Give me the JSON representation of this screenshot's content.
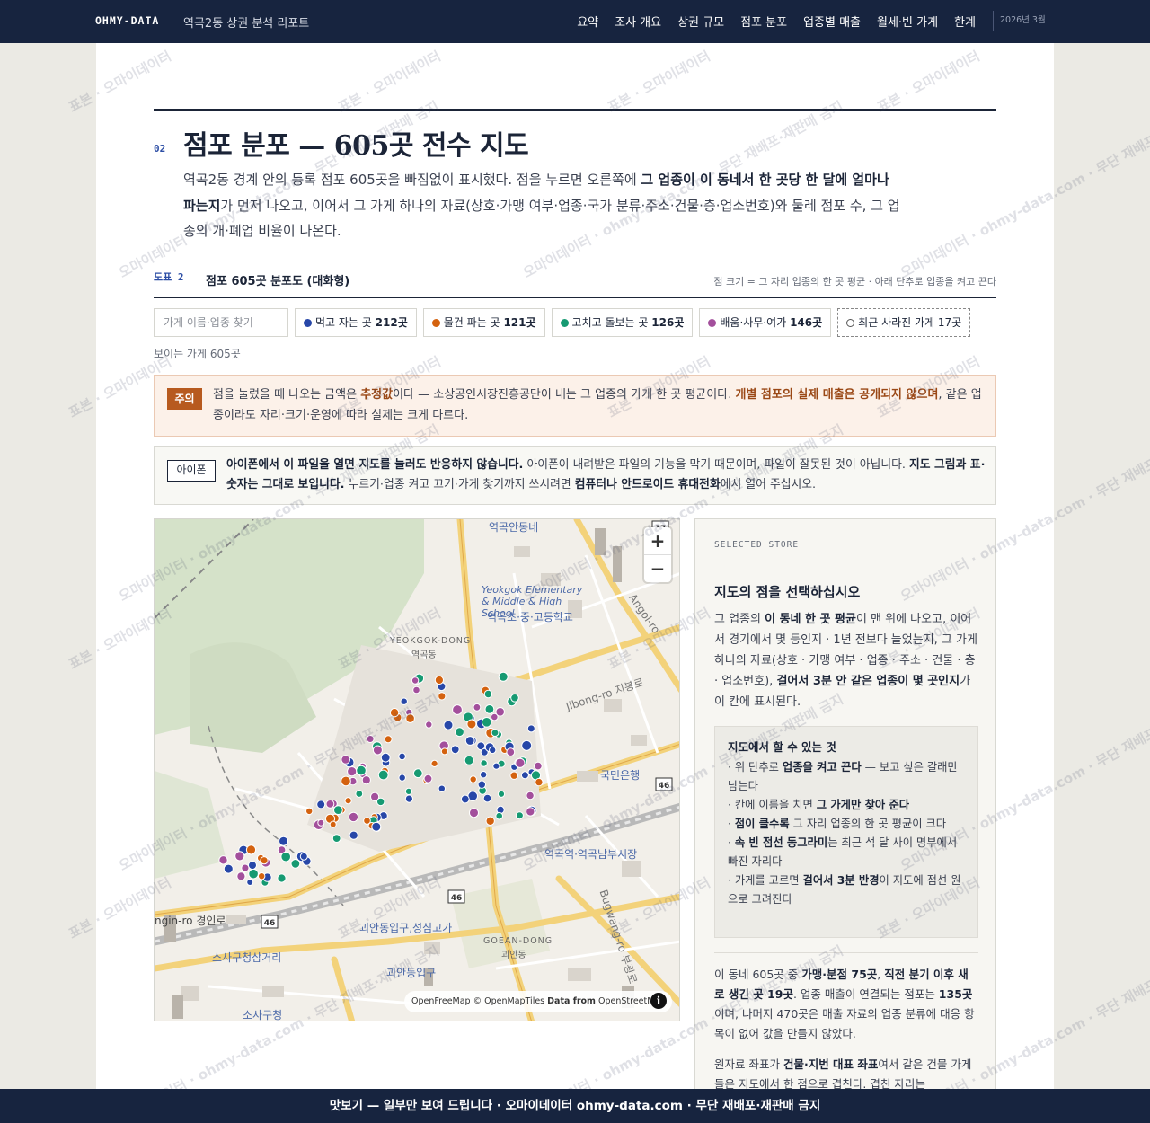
{
  "nav": {
    "brand": "OHMY-DATA",
    "report_title": "역곡2동 상권 분석 리포트",
    "links": [
      "요약",
      "조사 개요",
      "상권 규모",
      "점포 분포",
      "업종별 매출",
      "월세·빈 가게",
      "한계"
    ],
    "date": "2026년 3월"
  },
  "section": {
    "number": "02",
    "title": "점포 분포 — 605곳 전수 지도",
    "intro_1": "역곡2동 경계 안의 등록 점포 605곳을 빠짐없이 표시했다. 점을 누르면 오른쪽에 ",
    "intro_bold": "그 업종이 이 동네서 한 곳당 한 달에 얼마나 파는지",
    "intro_2": "가 먼저 나오고, 이어서 그 가게 하나의 자료(상호·가맹 여부·업종·국가 분류·주소·건물·층·업소번호)와 둘레 점포 수, 그 업종의 개·폐업 비율이 나온다."
  },
  "figure": {
    "caption": "도표 2",
    "title": "점포 605곳 분포도 (대화형)",
    "note": "점 크기 = 그 자리 업종의 한 곳 평균 · 아래 단추로 업종을 켜고 끈다"
  },
  "filters": {
    "search_placeholder": "가게 이름·업종 찾기",
    "chips": [
      {
        "label": "먹고 자는 곳",
        "count": "212곳",
        "color": "#2747a8"
      },
      {
        "label": "물건 파는 곳",
        "count": "121곳",
        "color": "#d4620f"
      },
      {
        "label": "고치고 돌보는 곳",
        "count": "126곳",
        "color": "#169a72"
      },
      {
        "label": "배움·사무·여가",
        "count": "146곳",
        "color": "#a34f9c"
      }
    ],
    "closed_label": "최근 사라진 가게 17곳",
    "visible_count": "보이는 가게 605곳"
  },
  "warning": {
    "tag": "주의",
    "text_1": "점을 눌렀을 때 나오는 금액은 ",
    "bold_1": "추정값",
    "text_2": "이다 — 소상공인시장진흥공단이 내는 그 업종의 가게 한 곳 평균이다. ",
    "bold_2": "개별 점포의 실제 매출은 공개되지 않으며",
    "text_3": ", 같은 업종이라도 자리·크기·운영에 따라 실제는 크게 다르다."
  },
  "ios_notice": {
    "tag": "아이폰",
    "bold_1": "아이폰에서 이 파일을 열면 지도를 눌러도 반응하지 않습니다.",
    "text_1": " 아이폰이 내려받은 파일의 기능을 막기 때문이며, 파일이 잘못된 것이 아닙니다. ",
    "bold_2": "지도 그림과 표·숫자는 그대로 보입니다.",
    "text_2": " 누르기·업종 켜고 끄기·가게 찾기까지 쓰시려면 ",
    "bold_3": "컴퓨터나 안드로이드 휴대전화",
    "text_3": "에서 열어 주십시오."
  },
  "map": {
    "zoom_in": "+",
    "zoom_out": "−",
    "attribution_1": "OpenFreeMap © OpenMapTiles ",
    "attribution_bold": "Data from",
    "attribution_2": " OpenStreetMap",
    "info": "i",
    "labels": {
      "station_top": "역곡안동네",
      "school_en": "Yeokgok Elementary & Middle & High School",
      "school_ko": "역곡초·중·고등학교",
      "district_en": "YEOKGOK-DONG",
      "district_ko": "역곡동",
      "bank": "국민은행",
      "market": "역곡역·역곡남부시장",
      "jibong": "Jibong-ro 지봉로",
      "angol": "Angol-ro",
      "gyeongin": "ngin-ro 경인로",
      "goean": "괴안동입구,성심고가",
      "goean_en": "GOEAN-DONG",
      "goean_ko": "괴안동",
      "goean2": "괴안동입구",
      "sosa_cross": "소사구청삼거리",
      "sosa_office": "소사구청",
      "bugwang": "Bugwang-ro 부광로",
      "route46a": "46",
      "route46b": "46",
      "route46c": "46",
      "route17": "17"
    }
  },
  "panel": {
    "kicker": "SELECTED STORE",
    "title": "지도의 점을 선택하십시오",
    "text_1": "그 업종의 ",
    "bold_1": "이 동네 한 곳 평균",
    "text_2": "이 맨 위에 나오고, 이어서 경기에서 몇 등인지 · 1년 전보다 늘었는지, 그 가게 하나의 자료(상호 · 가맹 여부 · 업종 · 주소 · 건물 · 층 · 업소번호), ",
    "bold_2": "걸어서 3분 안 같은 업종이 몇 곳인지",
    "text_3": "가 이 칸에 표시된다.",
    "tips_title": "지도에서 할 수 있는 것",
    "tips": [
      {
        "pre": "· 위 단추로 ",
        "bold": "업종을 켜고 끈다",
        "post": " — 보고 싶은 갈래만 남는다"
      },
      {
        "pre": "· 칸에 이름을 치면 ",
        "bold": "그 가게만 찾아 준다",
        "post": ""
      },
      {
        "pre": "· ",
        "bold": "점이 클수록",
        "post": " 그 자리 업종의 한 곳 평균이 크다"
      },
      {
        "pre": "· ",
        "bold": "속 빈 점선 동그라미",
        "post": "는 최근 석 달 사이 명부에서 빠진 자리다"
      },
      {
        "pre": "· 가게를 고르면 ",
        "bold": "걸어서 3분 반경",
        "post": "이 지도에 점선 원으로 그려진다"
      }
    ],
    "foot_1a": "이 동네 605곳 중 ",
    "foot_1b": "가맹·분점 75곳",
    "foot_1c": ", ",
    "foot_1d": "직전 분기 이후 새로 생긴 곳 19곳",
    "foot_1e": ". 업종 매출이 연결되는 점포는 ",
    "foot_1f": "135곳",
    "foot_1g": "이며, 나머지 470곳은 매출 자료의 업종 분류에 대응 항목이 없어 값을 만들지 않았다.",
    "foot_2a": "원자료 좌표가 ",
    "foot_2b": "건물·지번 대표 좌표",
    "foot_2c": "여서 같은 건물 가게들은 지도에서 한 점으로 겹친다. 겹친 자리는"
  },
  "watermark": {
    "text_a": "표본 · 오마이데이터",
    "text_b": "오마이데이터 · ohmy-data.com · 무단 재배포·재판매 금지"
  },
  "footer": {
    "text": "맛보기 — 일부만 보여 드립니다 · 오마이데이터 ohmy-data.com · 무단 재배포·재판매 금지"
  }
}
